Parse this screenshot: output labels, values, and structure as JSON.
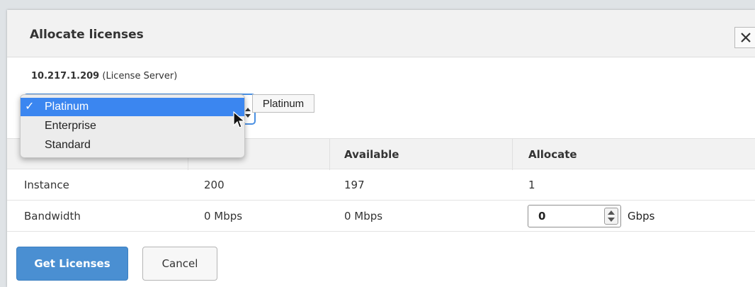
{
  "dialog": {
    "title": "Allocate licenses",
    "close_icon": "close-icon"
  },
  "server": {
    "ip": "10.217.1.209",
    "label": "(License Server)"
  },
  "edition_select": {
    "selected": "Platinum",
    "tooltip": "Platinum",
    "options": [
      {
        "label": "Platinum",
        "checked": true
      },
      {
        "label": "Enterprise",
        "checked": false
      },
      {
        "label": "Standard",
        "checked": false
      }
    ],
    "check_glyph": "✓"
  },
  "table": {
    "headers": [
      "",
      "",
      "Available",
      "Allocate"
    ],
    "rows": [
      {
        "name": "Instance",
        "total": "200",
        "available": "197",
        "allocate": "1"
      },
      {
        "name": "Bandwidth",
        "total": "0 Mbps",
        "available": "0 Mbps",
        "allocate_value": "0",
        "allocate_unit": "Gbps"
      }
    ]
  },
  "buttons": {
    "primary": "Get Licenses",
    "secondary": "Cancel"
  },
  "colors": {
    "accent": "#4a8fd2",
    "selected_option": "#3b86f0"
  }
}
